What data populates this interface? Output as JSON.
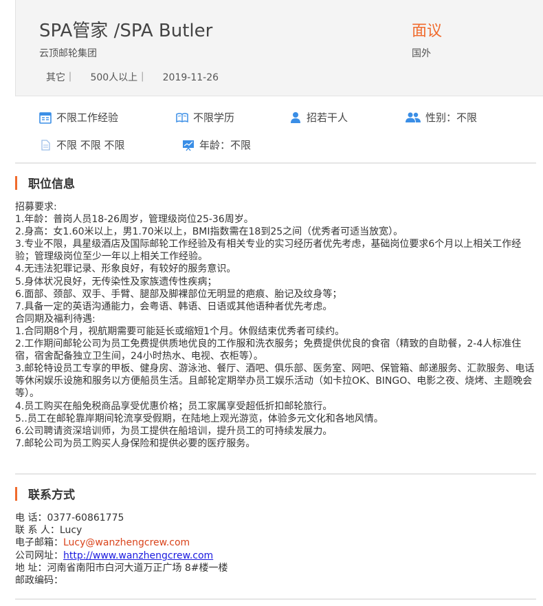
{
  "job": {
    "title": "SPA管家 /SPA Butler",
    "company": "云顶邮轮集团",
    "meta": [
      "其它｜",
      "500人以上｜",
      "2019-11-26"
    ],
    "salary": "面议",
    "location": "国外"
  },
  "requirements": {
    "experience": "不限工作经验",
    "education": "不限学历",
    "headcount": "招若干人",
    "gender": "性别：不限",
    "language": "不限 不限 不限",
    "age": "年龄：不限"
  },
  "sections": {
    "job_info": "职位信息",
    "contact": "联系方式"
  },
  "description": [
    "招募要求:",
    "1.年龄：普岗人员18-26周岁，管理级岗位25-36周岁。",
    "2.身高：女1.60米以上，男1.70米以上，BMI指数需在18到25之间（优秀者可适当放宽）。",
    "3.专业不限，具星级酒店及国际邮轮工作经验及有相关专业的实习经历者优先考虑，基础岗位要求6个月以上相关工作经验；管理级岗位至少一年以上相关工作经验。",
    "4.无违法犯罪记录、形象良好，有较好的服务意识。",
    "5.身体状况良好，无传染性及家族遗传性疾病；",
    "6.面部、颈部、双手、手臂、腿部及脚裸部位无明显的疤痕、胎记及纹身等；",
    "7.具备一定的英语沟通能力，会粤语、韩语、日语或其他语种者优先考虑。",
    "合同期及福利待遇:",
    "1.合同期8个月，视航期需要可能延长或缩短1个月。休假结束优秀者可续约。",
    "2.工作期间邮轮公司为员工免费提供质地优良的工作服和洗衣服务；免费提供优良的食宿（精致的自助餐，2-4人标准住宿，宿舍配备独立卫生间，24小时热水、电视、衣柜等）。",
    "3.邮轮特设员工专享的甲板、健身房、游泳池、餐厅、酒吧、俱乐部、医务室、网吧、保管箱、邮递服务、汇款服务、电话等休闲娱乐设施和服务以方便船员生活。且邮轮定期举办员工娱乐活动（如卡拉OK、BINGO、电影之夜、烧烤、主题晚会等）。",
    "4.员工购买在船免税商品享受优惠价格；员工家属享受超低折扣邮轮旅行。",
    "5..员工在邮轮靠岸期间轮流享受假期，在陆地上观光游览，体验多元文化和各地风情。",
    "6.公司聘请资深培训师，为员工提供在船培训，提升员工的可持续发展力。",
    "7.邮轮公司为员工购买人身保险和提供必要的医疗服务。"
  ],
  "contact": {
    "phone_label": "电 话：",
    "phone": "0377-60861775",
    "person_label": "联 系 人：",
    "person": "Lucy",
    "email_label": "电子邮箱：",
    "email": "Lucy@wanzhengcrew.com",
    "site_label": "公司网址：",
    "site": "http://www.wanzhengcrew.com",
    "address_label": "地 址：",
    "address": "河南省南阳市白河大道万正广场 8#楼一楼",
    "zip_label": "邮政编码：",
    "zip": ""
  },
  "colors": {
    "accent": "#f06a2c",
    "icon": "#3a8ee6",
    "link": "#1a1adf"
  }
}
